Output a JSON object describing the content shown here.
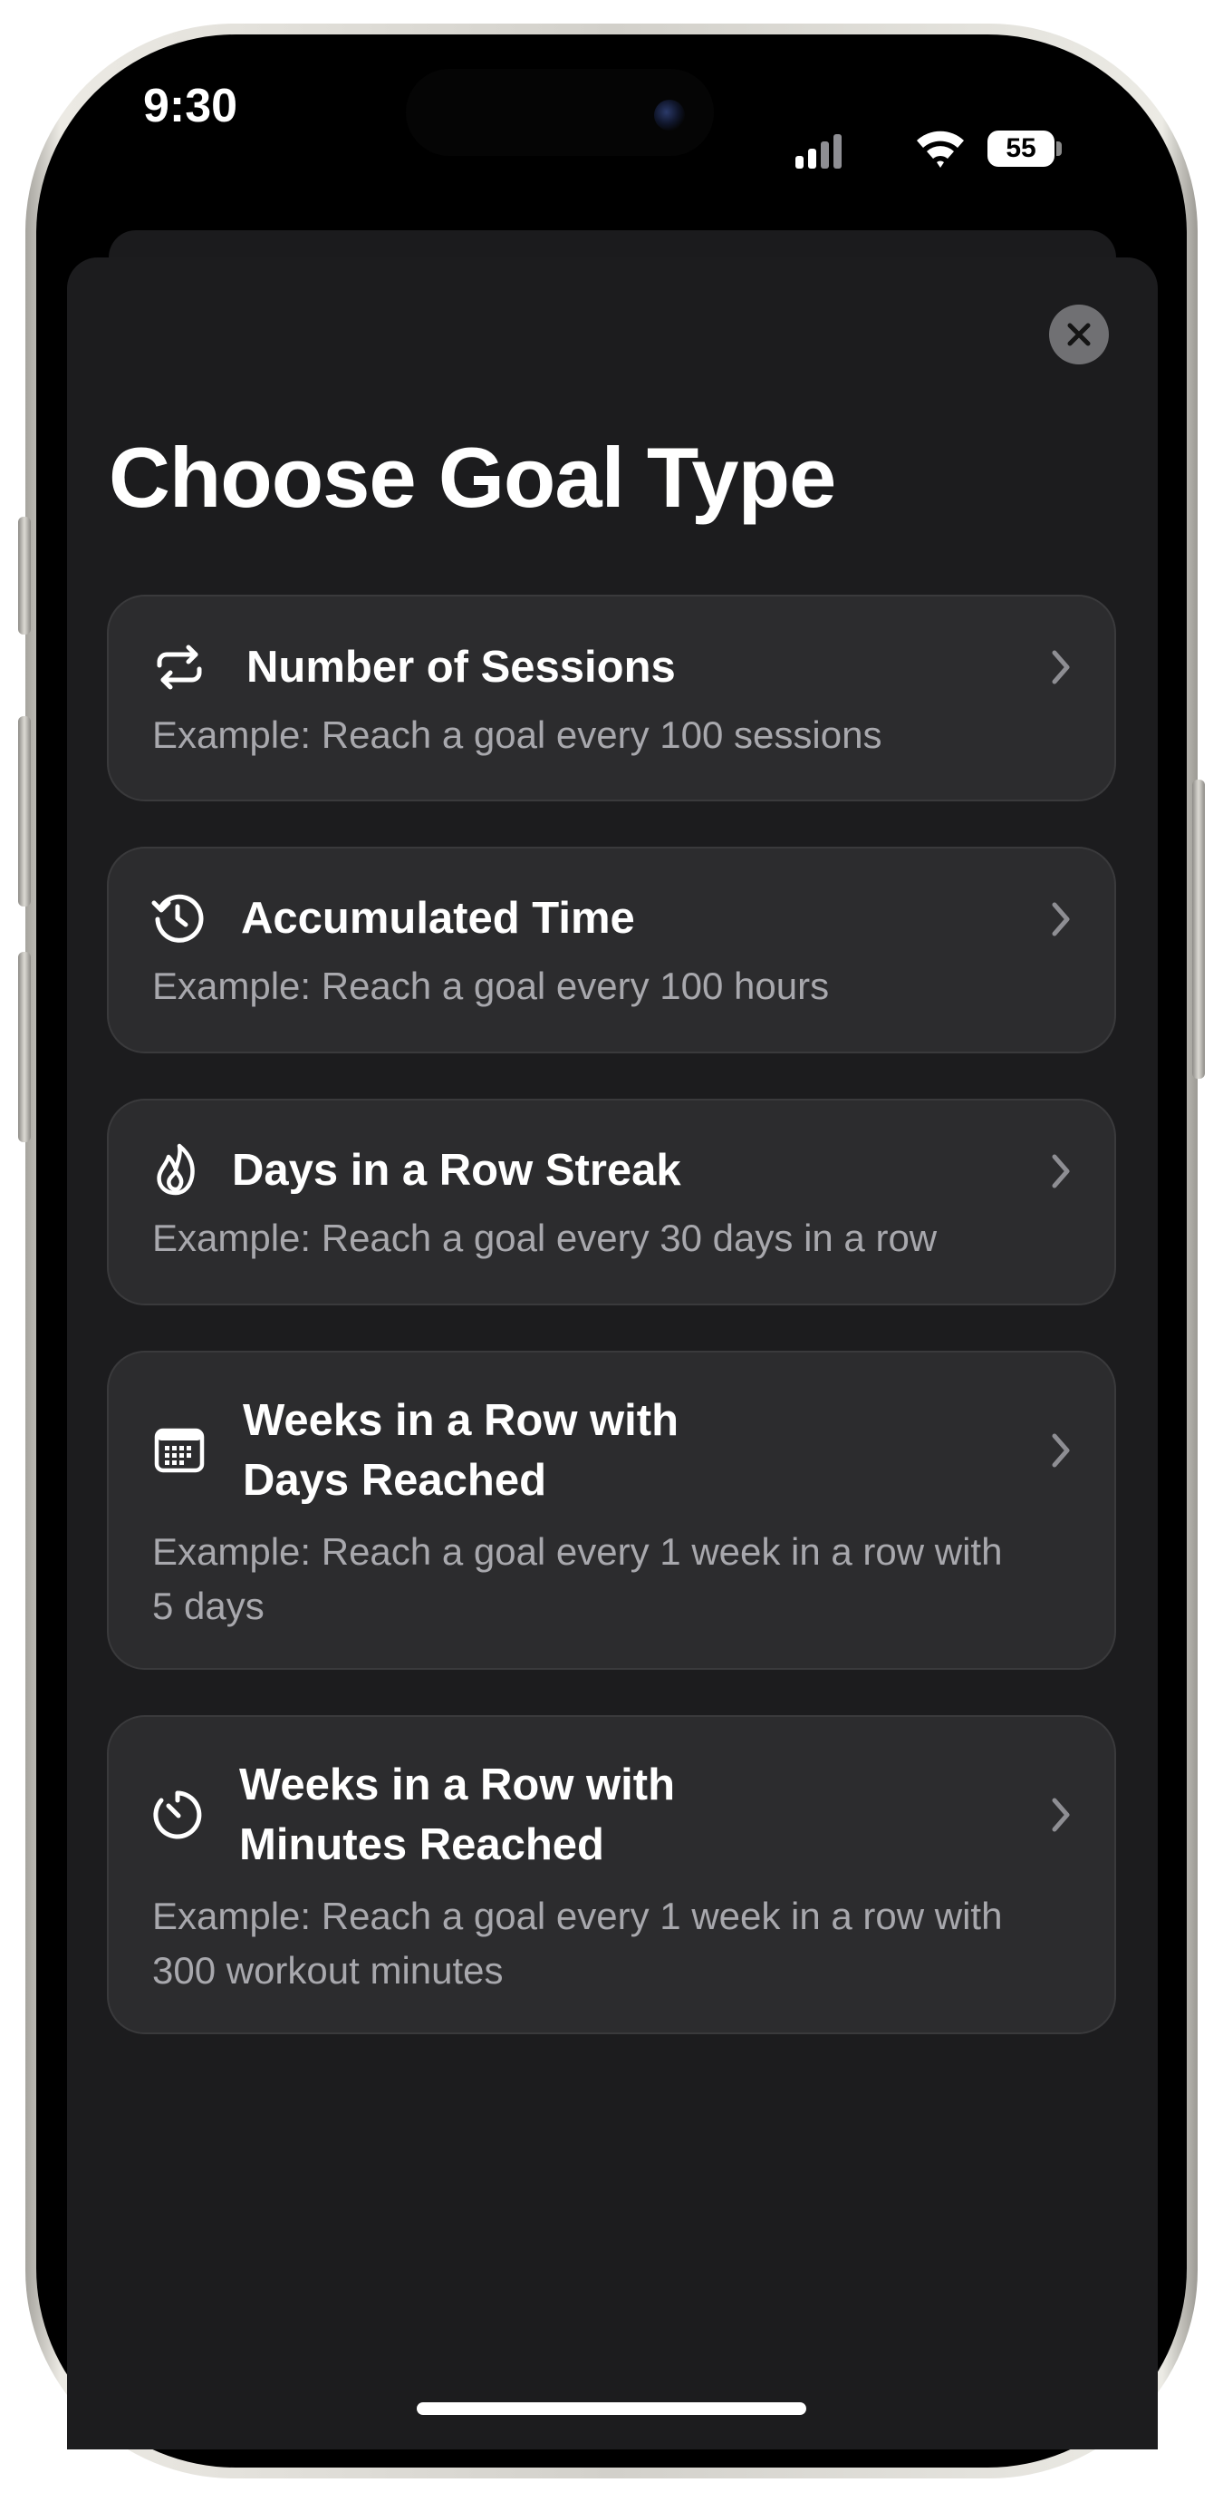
{
  "status_bar": {
    "time": "9:30",
    "battery": "55",
    "icons": [
      "cellular-signal-icon",
      "wifi-icon",
      "battery-icon"
    ]
  },
  "sheet": {
    "title": "Choose Goal Type",
    "close_icon": "close-icon"
  },
  "goal_types": [
    {
      "icon": "repeat-arrows-icon",
      "title": "Number of Sessions",
      "description": "Example: Reach a goal every 100 sessions"
    },
    {
      "icon": "history-clock-icon",
      "title": "Accumulated Time",
      "description": "Example: Reach a goal every 100 hours"
    },
    {
      "icon": "flame-icon",
      "title": "Days in a Row Streak",
      "description": "Example: Reach a goal every 30 days in a row"
    },
    {
      "icon": "calendar-icon",
      "title_line1": "Weeks in a Row with",
      "title_line2": "Days Reached",
      "description_line1": "Example: Reach a goal every 1 week in a row with",
      "description_line2": "5 days"
    },
    {
      "icon": "timer-icon",
      "title_line1": "Weeks in a Row with",
      "title_line2": "Minutes Reached",
      "description_line1": "Example: Reach a goal every 1 week in a row with",
      "description_line2": "300 workout minutes"
    }
  ],
  "colors": {
    "sheet_background": "#1c1c1e",
    "card_background": "#2c2c2e",
    "card_border": "#3a3a3c",
    "secondary_text": "#a8a8ad",
    "close_button": "#707073"
  }
}
